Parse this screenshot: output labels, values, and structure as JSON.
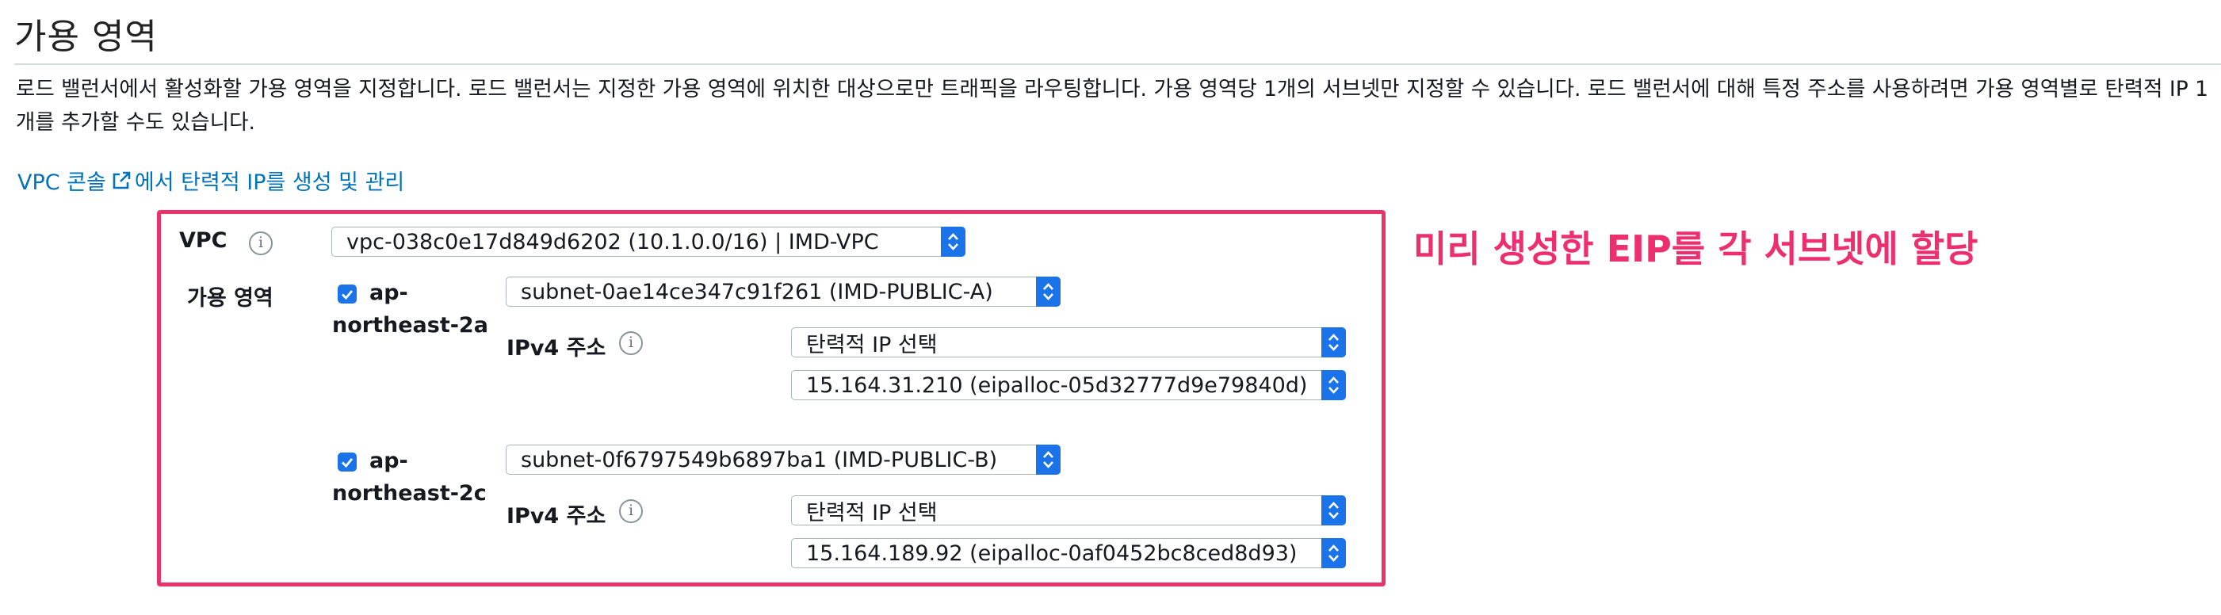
{
  "section": {
    "title": "가용 영역",
    "description": "로드 밸런서에서 활성화할 가용 영역을 지정합니다. 로드 밸런서는 지정한 가용 영역에 위치한 대상으로만 트래픽을 라우팅합니다. 가용 영역당 1개의 서브넷만 지정할 수 있습니다. 로드 밸런서에 대해 특정 주소를 사용하려면 가용 영역별로 탄력적 IP 1개를 추가할 수도 있습니다.",
    "link_prefix": "VPC 콘솔",
    "link_suffix": "에서 탄력적 IP를 생성 및 관리"
  },
  "form": {
    "vpc_label": "VPC",
    "vpc_value": "vpc-038c0e17d849d6202 (10.1.0.0/16) | IMD-VPC",
    "az_label": "가용 영역",
    "zones": [
      {
        "az_line1": "ap-",
        "az_line2": "northeast-2a",
        "checked": true,
        "subnet": "subnet-0ae14ce347c91f261 (IMD-PUBLIC-A)",
        "ipv4_label": "IPv4 주소",
        "ip_mode": "탄력적 IP 선택",
        "eip": "15.164.31.210 (eipalloc-05d32777d9e79840d)"
      },
      {
        "az_line1": "ap-",
        "az_line2": "northeast-2c",
        "checked": true,
        "subnet": "subnet-0f6797549b6897ba1 (IMD-PUBLIC-B)",
        "ipv4_label": "IPv4 주소",
        "ip_mode": "탄력적 IP 선택",
        "eip": "15.164.189.92 (eipalloc-0af0452bc8ced8d93)"
      }
    ]
  },
  "annotation": {
    "text": "미리 생성한 EIP를 각 서브넷에 할당",
    "color": "#ee2f6f"
  },
  "icons": {
    "info": "info-icon",
    "external": "external-link-icon",
    "stepper": "select-stepper-icon",
    "check": "checkmark-icon"
  },
  "colors": {
    "accent": "#1a73e8",
    "link": "#0073bb",
    "highlight_border": "#e8336b"
  }
}
